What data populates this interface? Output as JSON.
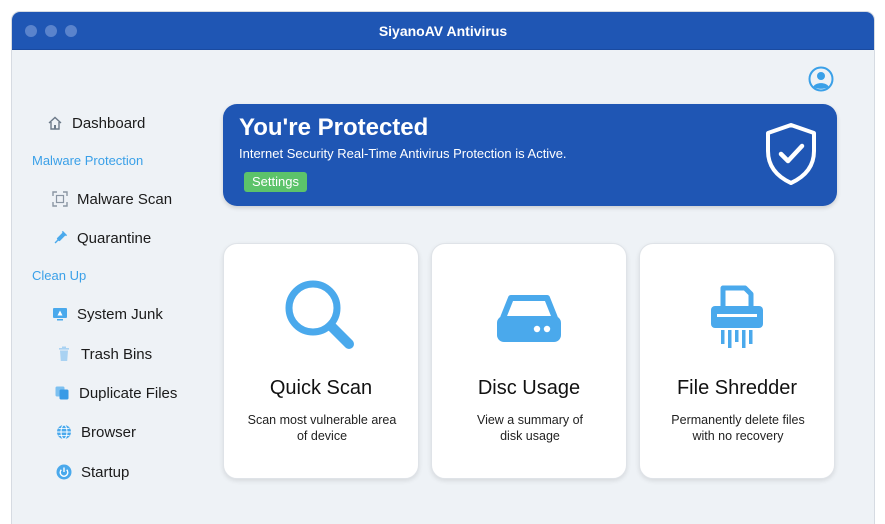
{
  "window": {
    "title": "SiyanoAV Antivirus"
  },
  "sidebar": {
    "dashboard": "Dashboard",
    "section_malware": "Malware Protection",
    "malware_scan": "Malware Scan",
    "quarantine": "Quarantine",
    "section_cleanup": "Clean Up",
    "system_junk": "System Junk",
    "trash_bins": "Trash Bins",
    "duplicate_files": "Duplicate Files",
    "browser": "Browser",
    "startup": "Startup"
  },
  "banner": {
    "title": "You're Protected",
    "subtitle": "Internet Security Real-Time Antivirus Protection is Active.",
    "settings_label": "Settings"
  },
  "cards": [
    {
      "title": "Quick Scan",
      "desc_line1": "Scan most vulnerable area",
      "desc_line2": "of device"
    },
    {
      "title": "Disc Usage",
      "desc_line1": "View a summary of",
      "desc_line2": "disk usage"
    },
    {
      "title": "File Shredder",
      "desc_line1": "Permanently delete files",
      "desc_line2": "with no recovery"
    }
  ],
  "colors": {
    "accent": "#1f56b4",
    "section_label": "#3aa0e8",
    "icon_blue": "#4aa9ec",
    "settings_green": "#5cc36a"
  }
}
